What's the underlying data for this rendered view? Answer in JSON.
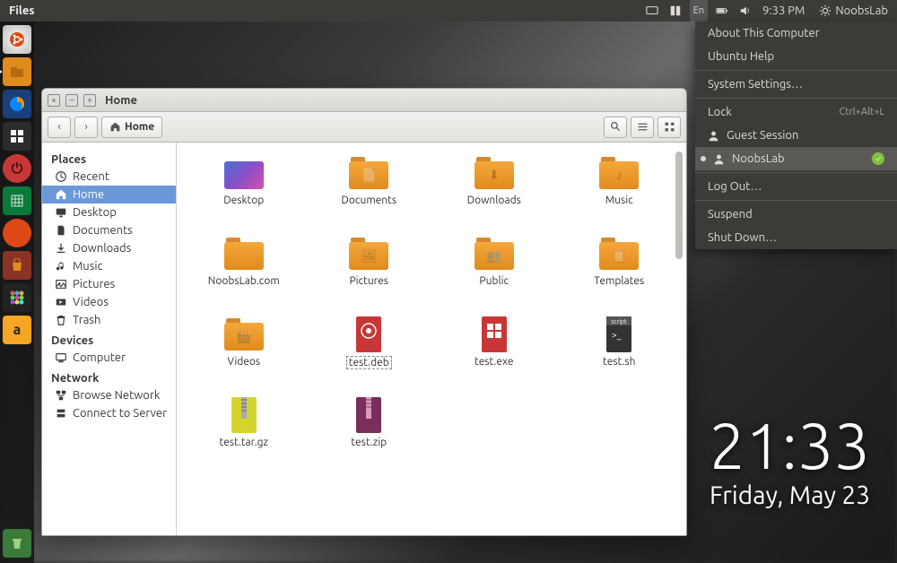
{
  "topbar": {
    "app_title": "Files",
    "lang": "En",
    "time": "9:33 PM",
    "user": "NoobsLab"
  },
  "desktop_clock": {
    "time": "21:33",
    "date": "Friday, May 23"
  },
  "sysmenu": {
    "about": "About This Computer",
    "help": "Ubuntu Help",
    "settings": "System Settings…",
    "lock": "Lock",
    "lock_sc": "Ctrl+Alt+L",
    "guest": "Guest Session",
    "user": "NoobsLab",
    "logout": "Log Out…",
    "suspend": "Suspend",
    "shutdown": "Shut Down…"
  },
  "window": {
    "title": "Home",
    "path": "Home"
  },
  "sidebar": {
    "places": "Places",
    "recent": "Recent",
    "home": "Home",
    "desktop": "Desktop",
    "documents": "Documents",
    "downloads": "Downloads",
    "music": "Music",
    "pictures": "Pictures",
    "videos": "Videos",
    "trash": "Trash",
    "devices": "Devices",
    "computer": "Computer",
    "network": "Network",
    "browse": "Browse Network",
    "connect": "Connect to Server"
  },
  "files": {
    "desktop": "Desktop",
    "documents": "Documents",
    "downloads": "Downloads",
    "music": "Music",
    "noobslab": "NoobsLab.com",
    "pictures": "Pictures",
    "public": "Public",
    "templates": "Templates",
    "videos": "Videos",
    "testdeb": "test.deb",
    "testexe": "test.exe",
    "testsh": "test.sh",
    "testtar": "test.tar.gz",
    "testzip": "test.zip",
    "script_badge": "script"
  }
}
